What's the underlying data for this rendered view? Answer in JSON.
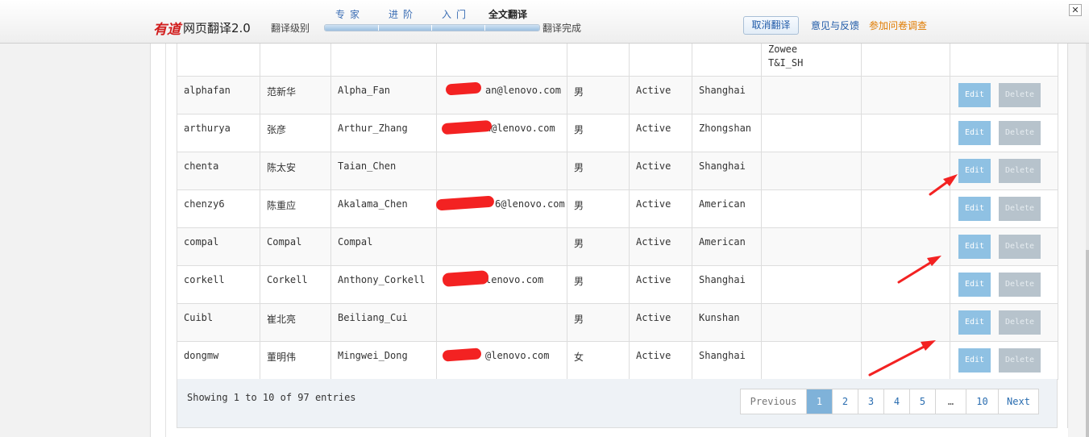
{
  "toolbar": {
    "logo": "有道",
    "product": "网页翻译2.0",
    "level_label": "翻译级别",
    "levels": [
      "专家",
      "进阶",
      "入门"
    ],
    "current_mode": "全文翻译",
    "progress_fraction": 1.0,
    "status": "翻译完成",
    "cancel_label": "取消翻译",
    "feedback_label": "意见与反馈",
    "survey_label": "参加问卷调查",
    "close_glyph": "✕",
    "colors": {
      "link": "#1f5aa8",
      "survey": "#e07b00",
      "logo": "#d11d1d"
    }
  },
  "table": {
    "partial_row": {
      "department": "Zowee\nT&I_SH"
    },
    "rows": [
      {
        "username": "alphafan",
        "cn_name": "范新华",
        "en_name": "Alpha_Fan",
        "email": "al…an@lenovo.com",
        "email_visible": "an@lenovo.com",
        "gender": "男",
        "status": "Active",
        "location": "Shanghai"
      },
      {
        "username": "arthurya",
        "cn_name": "张彦",
        "en_name": "Arthur_Zhang",
        "email": "arthurya@lenovo.com",
        "email_visible": "a@lenovo.com",
        "gender": "男",
        "status": "Active",
        "location": "Zhongshan"
      },
      {
        "username": "chenta",
        "cn_name": "陈太安",
        "en_name": "Taian_Chen",
        "email": "",
        "email_visible": "",
        "gender": "男",
        "status": "Active",
        "location": "Shanghai"
      },
      {
        "username": "chenzy6",
        "cn_name": "陈重应",
        "en_name": "Akalama_Chen",
        "email": "chenzy6@lenovo.com",
        "email_visible": "6@lenovo.com",
        "gender": "男",
        "status": "Active",
        "location": "American"
      },
      {
        "username": "compal",
        "cn_name": "Compal",
        "en_name": "Compal",
        "email": "",
        "email_visible": "",
        "gender": "男",
        "status": "Active",
        "location": "American"
      },
      {
        "username": "corkell",
        "cn_name": "Corkell",
        "en_name": "Anthony_Corkell",
        "email": "corkell@lenovo.com",
        "email_visible": "lenovo.com",
        "gender": "男",
        "status": "Active",
        "location": "Shanghai"
      },
      {
        "username": "Cuibl",
        "cn_name": "崔北亮",
        "en_name": "Beiliang_Cui",
        "email": "",
        "email_visible": "",
        "gender": "男",
        "status": "Active",
        "location": "Kunshan"
      },
      {
        "username": "dongmw",
        "cn_name": "董明伟",
        "en_name": "Mingwei_Dong",
        "email": "dongmw@lenovo.com",
        "email_visible": "@lenovo.com",
        "gender": "女",
        "status": "Active",
        "location": "Shanghai"
      }
    ],
    "edit_label": "Edit",
    "delete_label": "Delete"
  },
  "footer": {
    "showing_text": "Showing 1 to 10 of 97 entries",
    "pagination": {
      "previous_label": "Previous",
      "pages": [
        "1",
        "2",
        "3",
        "4",
        "5",
        "…",
        "10"
      ],
      "active_page": "1",
      "next_label": "Next"
    }
  },
  "annotation_color": "#f32222"
}
